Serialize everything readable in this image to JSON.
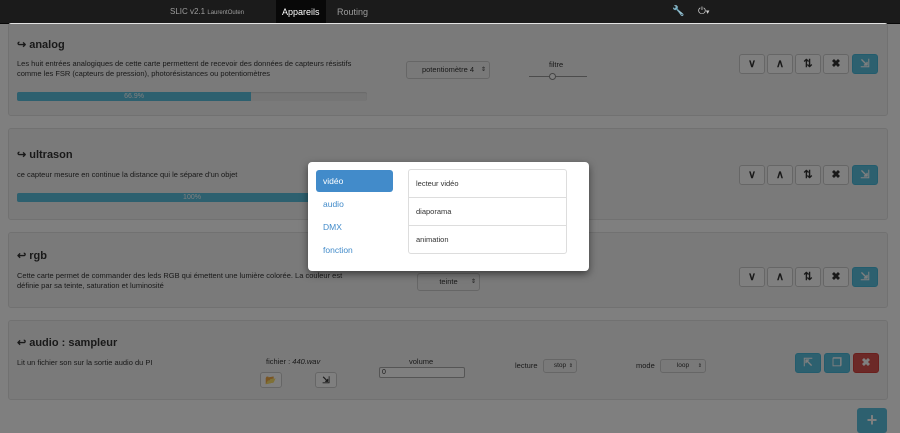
{
  "navbar": {
    "brand": "SLIC v2.1",
    "brand_author": "LaurentOuten",
    "tabs": [
      {
        "label": "Appareils"
      },
      {
        "label": "Routing"
      }
    ],
    "wrench_glyph": "🔧",
    "power_glyph": "⏻",
    "power_caret": "▾"
  },
  "glyphs": {
    "output": "↪",
    "input": "↩",
    "chevron_down": "∨",
    "chevron_up": "∧",
    "sort": "⇅",
    "remove": "✖",
    "export": "⇲",
    "import": "⇱",
    "copy": "❐",
    "folder": "📂",
    "caret": "⇕",
    "plus": "+"
  },
  "panels": {
    "analog": {
      "title": "analog",
      "description": "Les huit entrées analogiques de cette carte permettent de recevoir des données de capteurs résistifs comme les FSR (capteurs de pression), photorésistances ou potentiomètres",
      "progress": 66.9,
      "progress_label": "66.9%",
      "select_value": "potentiomètre 4",
      "filter_label": "filtre",
      "filter_level": 0.4
    },
    "ultrason": {
      "title": "ultrason",
      "description": "ce capteur mesure en continue la distance qui le sépare d'un objet",
      "progress": 100,
      "progress_label": "100%"
    },
    "rgb": {
      "title": "rgb",
      "description": "Cette carte permet de commander des leds RGB qui émettent une lumière colorée. La couleur est définie par sa teinte, saturation et luminosité",
      "select_value": "teinte"
    },
    "audio": {
      "title": "audio : sampleur",
      "description": "Lit un fichier son sur la sortie audio du PI",
      "file_label": "fichier :",
      "file_name": "440.wav",
      "volume_label": "volume",
      "volume_value": "0",
      "lecture_label": "lecture",
      "lecture_value": "stop",
      "mode_label": "mode",
      "mode_value": "loop"
    }
  },
  "modal": {
    "categories": [
      {
        "label": "vidéo",
        "active": true
      },
      {
        "label": "audio"
      },
      {
        "label": "DMX"
      },
      {
        "label": "fonction"
      }
    ],
    "items": [
      {
        "label": "lecteur vidéo"
      },
      {
        "label": "diaporama"
      },
      {
        "label": "animation"
      }
    ]
  },
  "colors": {
    "info": "#5bc0de",
    "danger": "#d9534f",
    "primary": "#428bca",
    "navbar": "#1b1b1b"
  }
}
